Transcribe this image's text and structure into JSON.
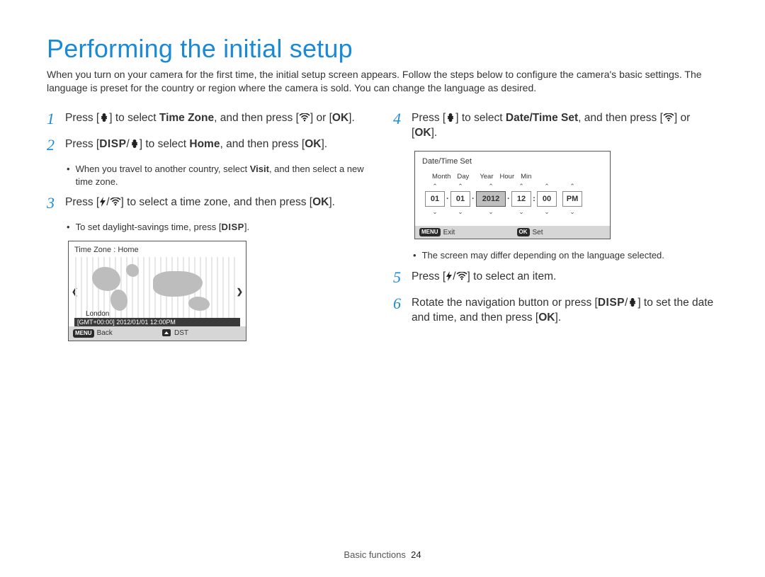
{
  "title": "Performing the initial setup",
  "intro": "When you turn on your camera for the first time, the initial setup screen appears. Follow the steps below to configure the camera's basic settings. The language is preset for the country or region where the camera is sold. You can change the language as desired.",
  "steps": {
    "s1": {
      "num": "1",
      "p1": "Press [",
      "p2": "] to select ",
      "bold1": "Time Zone",
      "p3": ", and then press [",
      "p4": "] or [",
      "p5": "]."
    },
    "s2": {
      "num": "2",
      "p1": "Press [",
      "p2": "/",
      "p3": "] to select ",
      "bold1": "Home",
      "p4": ", and then press [",
      "p5": "].",
      "sub1a": "When you travel to another country, select ",
      "sub1b": "Visit",
      "sub1c": ", and then select a new time zone."
    },
    "s3": {
      "num": "3",
      "p1": "Press [",
      "p2": "/",
      "p3": "] to select a time zone, and then press [",
      "p4": "].",
      "sub1a": "To set daylight-savings time, press [",
      "sub1b": "]."
    },
    "s4": {
      "num": "4",
      "p1": "Press [",
      "p2": "] to select ",
      "bold1": "Date/Time Set",
      "p3": ", and then press [",
      "p4": "] or [",
      "p5": "]."
    },
    "s4sub": "The screen may differ depending on the language selected.",
    "s5": {
      "num": "5",
      "p1": "Press [",
      "p2": "/",
      "p3": "] to select an item."
    },
    "s6": {
      "num": "6",
      "p1": "Rotate the navigation button or press [",
      "p2": "/",
      "p3": "] to set the date and time, and then press [",
      "p4": "]."
    }
  },
  "labels": {
    "DISP": "DISP",
    "OK": "OK",
    "MENU": "MENU"
  },
  "tzPanel": {
    "title": "Time Zone : Home",
    "city": "London",
    "gmt": "[GMT+00:00] 2012/01/01 12:00PM",
    "back": "Back",
    "dst": "DST"
  },
  "dtPanel": {
    "title": "Date/Time Set",
    "hdr": {
      "month": "Month",
      "day": "Day",
      "year": "Year",
      "hour": "Hour",
      "min": "Min"
    },
    "vals": {
      "month": "01",
      "day": "01",
      "year": "2012",
      "hour": "12",
      "min": "00",
      "ampm": "PM"
    },
    "exit": "Exit",
    "set": "Set"
  },
  "footer": {
    "section": "Basic functions",
    "page": "24"
  }
}
